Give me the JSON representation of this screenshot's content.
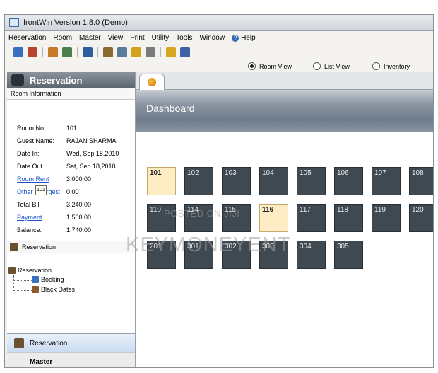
{
  "window": {
    "title": "frontWin Version 1.8.0 (Demo)"
  },
  "menu": [
    "Reservation",
    "Room",
    "Master",
    "View",
    "Print",
    "Utility",
    "Tools",
    "Window",
    "Help"
  ],
  "toolbar_icons": [
    "edit-icon",
    "printer-icon",
    "guest-icon",
    "card-icon",
    "monitor-icon",
    "users-icon",
    "notepad-icon",
    "search-icon",
    "broom-icon",
    "lock-icon",
    "save-icon"
  ],
  "view_options": [
    {
      "label": "Room View",
      "selected": true
    },
    {
      "label": "List View",
      "selected": false
    },
    {
      "label": "Inventory",
      "selected": false
    }
  ],
  "sidebar": {
    "title": "Reservation",
    "subtitle": "Room Information",
    "info": [
      {
        "label": "Room No.",
        "value": "101",
        "link": false
      },
      {
        "label": "Guest Name:",
        "value": "RAJAN SHARMA",
        "link": false
      },
      {
        "label": "Date In:",
        "value": "Wed, Sep 15,2010",
        "link": false
      },
      {
        "label": "Date Out",
        "value": "Sat, Sep 18,2010",
        "link": false
      },
      {
        "label": "Room Rent",
        "value": "3,000.00",
        "link": true
      },
      {
        "label": "Other Charges:",
        "value": "0.00",
        "link": true
      },
      {
        "label": "Total Bill",
        "value": "3,240.00",
        "link": false
      },
      {
        "label": "Payment",
        "value": "1,500.00",
        "link": true
      },
      {
        "label": "Balance:",
        "value": "1,740.00",
        "link": false
      }
    ],
    "section_label": "Reservation",
    "tree": {
      "root": "Reservation",
      "children": [
        "Booking",
        "Black Dates"
      ]
    },
    "bottom_buttons": [
      "Reservation",
      "Master"
    ]
  },
  "main": {
    "dashboard_title": "Dashboard",
    "tooltip": "101",
    "rooms": [
      [
        "101",
        "102",
        "103",
        "104",
        "105",
        "106",
        "107",
        "108"
      ],
      [
        "110",
        "114",
        "115",
        "116",
        "117",
        "118",
        "119",
        "120"
      ],
      [
        "201",
        "301",
        "302",
        "303",
        "304",
        "305"
      ]
    ],
    "selected_rooms": [
      "101",
      "116"
    ]
  },
  "watermark": {
    "small": "POSTED ON JIJI",
    "large": "KEYMONEYENT"
  }
}
